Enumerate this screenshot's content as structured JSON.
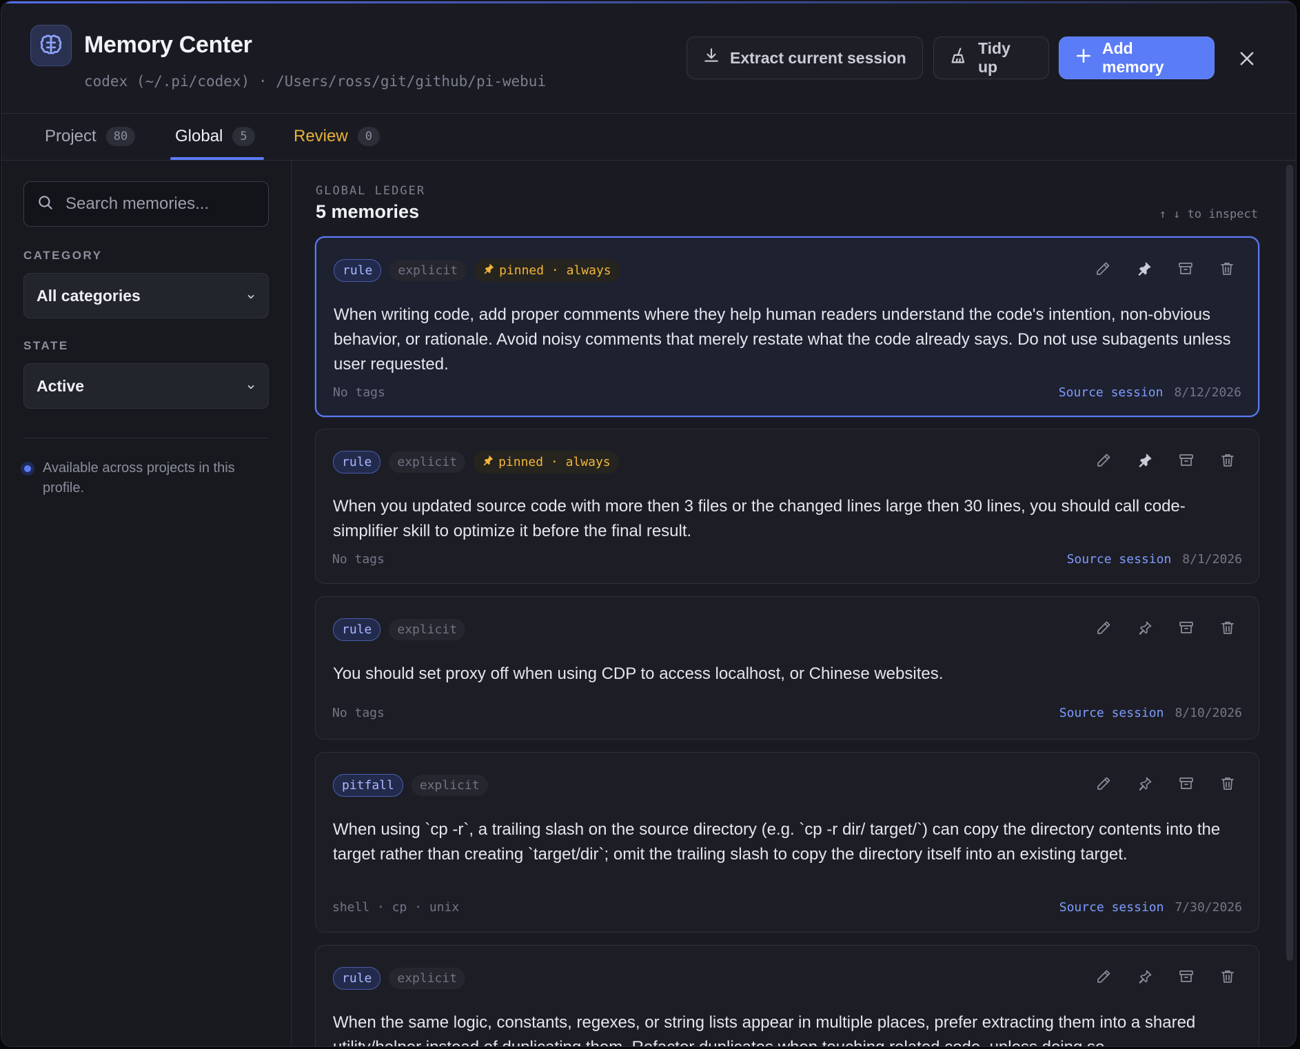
{
  "header": {
    "title": "Memory Center",
    "subtitle": "codex (~/.pi/codex) · /Users/ross/git/github/pi-webui",
    "app_icon": "brain-icon",
    "buttons": {
      "extract": "Extract current session",
      "tidy": "Tidy up",
      "add": "Add memory"
    }
  },
  "tabs": [
    {
      "label": "Project",
      "count": "80"
    },
    {
      "label": "Global",
      "count": "5",
      "active": true
    },
    {
      "label": "Review",
      "count": "0"
    }
  ],
  "sidebar": {
    "search_placeholder": "Search memories...",
    "category_label": "CATEGORY",
    "category_value": "All categories",
    "state_label": "STATE",
    "state_value": "Active",
    "note": "Available across projects in this profile."
  },
  "main": {
    "eyebrow": "GLOBAL LEDGER",
    "count_title": "5 memories",
    "hint": "↑ ↓ to inspect"
  },
  "memories": [
    {
      "category": "rule",
      "source": "explicit",
      "pinned": "pinned · always",
      "text": "When writing code, add proper comments where they help human readers understand the code's intention, non-obvious behavior, or rationale. Avoid noisy comments that merely restate what the code already says. Do not use subagents unless user requested.",
      "tags": "No tags",
      "source_link": "Source session",
      "date": "8/12/2026"
    },
    {
      "category": "rule",
      "source": "explicit",
      "pinned": "pinned · always",
      "text": "When you updated source code with more then 3 files or the changed lines large then 30 lines, you should call code-simplifier skill to optimize it before the final result.",
      "tags": "No tags",
      "source_link": "Source session",
      "date": "8/1/2026"
    },
    {
      "category": "rule",
      "source": "explicit",
      "pinned": "",
      "text": "You should set proxy off when using CDP to access localhost, or Chinese websites.",
      "tags": "No tags",
      "source_link": "Source session",
      "date": "8/10/2026"
    },
    {
      "category": "pitfall",
      "source": "explicit",
      "pinned": "",
      "text": "When using `cp -r`, a trailing slash on the source directory (e.g. `cp -r dir/ target/`) can copy the directory contents into the target rather than creating `target/dir`; omit the trailing slash to copy the directory itself into an existing target.",
      "tags": "shell · cp · unix",
      "source_link": "Source session",
      "date": "7/30/2026"
    },
    {
      "category": "rule",
      "source": "explicit",
      "pinned": "",
      "text": "When the same logic, constants, regexes, or string lists appear in multiple places, prefer extracting them into a shared utility/helper instead of duplicating them. Refactor duplicates when touching related code, unless doing so",
      "tags": "",
      "source_link": "",
      "date": ""
    }
  ],
  "colors": {
    "accent": "#5b7cf7",
    "pinned": "#f2b53a",
    "review": "#e8b23a",
    "background": "#1a1b22"
  }
}
